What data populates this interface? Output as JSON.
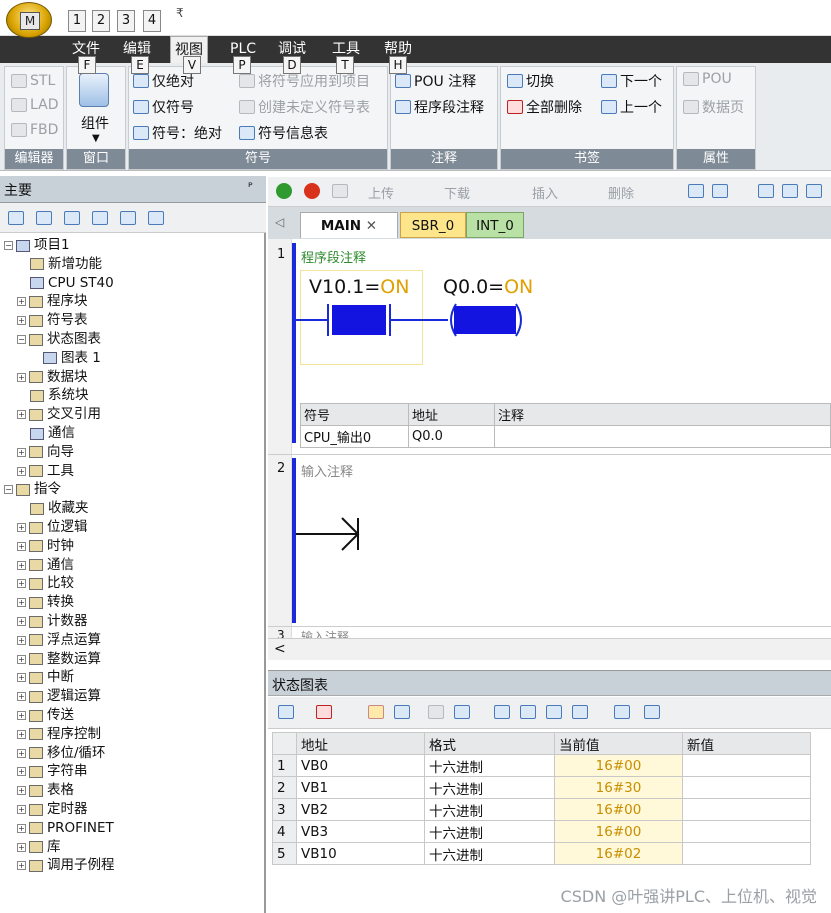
{
  "qat": {
    "orb_letter": "M",
    "keys": [
      "1",
      "2",
      "3",
      "4"
    ],
    "arrow": "₹"
  },
  "menu": {
    "items": [
      {
        "label": "文件",
        "tip": "F"
      },
      {
        "label": "编辑",
        "tip": "E"
      },
      {
        "label": "视图",
        "tip": "V"
      },
      {
        "label": "PLC",
        "tip": "P"
      },
      {
        "label": "调试",
        "tip": "D"
      },
      {
        "label": "工具",
        "tip": "T"
      },
      {
        "label": "帮助",
        "tip": "H"
      }
    ]
  },
  "ribbon": {
    "editor": {
      "stl": "STL",
      "lad": "LAD",
      "fbd": "FBD",
      "label": "编辑器"
    },
    "window": {
      "component": "组件",
      "label": "窗口"
    },
    "symbol": {
      "abs_only": "仅绝对",
      "sym_only": "仅符号",
      "sym_abs": "符号：绝对",
      "apply": "将符号应用到项目",
      "create_undef": "创建未定义符号表",
      "sym_info": "符号信息表",
      "label": "符号"
    },
    "comment": {
      "pou": "POU 注释",
      "network": "程序段注释",
      "label": "注释"
    },
    "bookmark": {
      "toggle": "切换",
      "clear_all": "全部删除",
      "next": "下一个",
      "prev": "上一个",
      "label": "书签"
    },
    "props": {
      "pou": "POU",
      "data_page": "数据页",
      "label": "属性"
    }
  },
  "left": {
    "title": "主要",
    "pin": "ᴾ",
    "tree": [
      {
        "label": "项目1",
        "exp": "−",
        "level": 0,
        "ico": "comp"
      },
      {
        "label": "新增功能",
        "level": 2,
        "ico": ""
      },
      {
        "label": "CPU ST40",
        "level": 2,
        "ico": "cpu"
      },
      {
        "label": "程序块",
        "exp": "+",
        "level": 1,
        "ico": "f"
      },
      {
        "label": "符号表",
        "exp": "+",
        "level": 1,
        "ico": "f"
      },
      {
        "label": "状态图表",
        "exp": "−",
        "level": 1,
        "ico": "f"
      },
      {
        "label": "图表 1",
        "level": 3,
        "ico": "comp"
      },
      {
        "label": "数据块",
        "exp": "+",
        "level": 1,
        "ico": "f"
      },
      {
        "label": "系统块",
        "level": 2,
        "ico": "f"
      },
      {
        "label": "交叉引用",
        "exp": "+",
        "level": 1,
        "ico": "f"
      },
      {
        "label": "通信",
        "level": 2,
        "ico": "cpu"
      },
      {
        "label": "向导",
        "exp": "+",
        "level": 1,
        "ico": "f"
      },
      {
        "label": "工具",
        "exp": "+",
        "level": 1,
        "ico": "f"
      },
      {
        "label": "指令",
        "exp": "−",
        "level": 0,
        "ico": "f"
      },
      {
        "label": "收藏夹",
        "level": 2,
        "ico": "f"
      },
      {
        "label": "位逻辑",
        "exp": "+",
        "level": 1,
        "ico": "f"
      },
      {
        "label": "时钟",
        "exp": "+",
        "level": 1,
        "ico": "f"
      },
      {
        "label": "通信",
        "exp": "+",
        "level": 1,
        "ico": "f"
      },
      {
        "label": "比较",
        "exp": "+",
        "level": 1,
        "ico": "f"
      },
      {
        "label": "转换",
        "exp": "+",
        "level": 1,
        "ico": "f"
      },
      {
        "label": "计数器",
        "exp": "+",
        "level": 1,
        "ico": "f"
      },
      {
        "label": "浮点运算",
        "exp": "+",
        "level": 1,
        "ico": "f"
      },
      {
        "label": "整数运算",
        "exp": "+",
        "level": 1,
        "ico": "f"
      },
      {
        "label": "中断",
        "exp": "+",
        "level": 1,
        "ico": "f"
      },
      {
        "label": "逻辑运算",
        "exp": "+",
        "level": 1,
        "ico": "f"
      },
      {
        "label": "传送",
        "exp": "+",
        "level": 1,
        "ico": "f"
      },
      {
        "label": "程序控制",
        "exp": "+",
        "level": 1,
        "ico": "f"
      },
      {
        "label": "移位/循环",
        "exp": "+",
        "level": 1,
        "ico": "f"
      },
      {
        "label": "字符串",
        "exp": "+",
        "level": 1,
        "ico": "f"
      },
      {
        "label": "表格",
        "exp": "+",
        "level": 1,
        "ico": "f"
      },
      {
        "label": "定时器",
        "exp": "+",
        "level": 1,
        "ico": "f"
      },
      {
        "label": "PROFINET",
        "exp": "+",
        "level": 1,
        "ico": "f"
      },
      {
        "label": "库",
        "exp": "+",
        "level": 1,
        "ico": "f"
      },
      {
        "label": "调用子例程",
        "exp": "+",
        "level": 1,
        "ico": "f"
      }
    ]
  },
  "editor": {
    "toolbar": {
      "upload": "上传",
      "download": "下载",
      "insert": "插入",
      "delete": "删除"
    },
    "tabs": [
      "MAIN",
      "SBR_0",
      "INT_0"
    ],
    "tab_close": "✕",
    "net1": {
      "num": "1",
      "comment": "程序段注释",
      "contact_sym": "V10.1",
      "contact_state": "ON",
      "coil_sym": "Q0.0",
      "coil_state": "ON",
      "symtable": {
        "headers": [
          "符号",
          "地址",
          "注释"
        ],
        "row": [
          "CPU_输出0",
          "Q0.0",
          ""
        ]
      }
    },
    "net2": {
      "num": "2",
      "comment": "输入注释"
    },
    "net3": {
      "num": "3",
      "comment": "输入注释"
    },
    "scroll_left": "<"
  },
  "status_chart": {
    "title": "状态图表",
    "headers": [
      "",
      "地址",
      "格式",
      "当前值",
      "新值"
    ],
    "rows": [
      {
        "n": "1",
        "addr": "VB0",
        "fmt": "十六进制",
        "cur": "16#00",
        "new": ""
      },
      {
        "n": "2",
        "addr": "VB1",
        "fmt": "十六进制",
        "cur": "16#30",
        "new": ""
      },
      {
        "n": "3",
        "addr": "VB2",
        "fmt": "十六进制",
        "cur": "16#00",
        "new": ""
      },
      {
        "n": "4",
        "addr": "VB3",
        "fmt": "十六进制",
        "cur": "16#00",
        "new": ""
      },
      {
        "n": "5",
        "addr": "VB10",
        "fmt": "十六进制",
        "cur": "16#02",
        "new": ""
      }
    ]
  },
  "watermark": "CSDN @叶强讲PLC、上位机、视觉",
  "colors": {
    "on": "#e0a000",
    "ladder": "#1b2ad8",
    "cur_value": "#c98e00",
    "cur_bg": "#fff9d9"
  }
}
